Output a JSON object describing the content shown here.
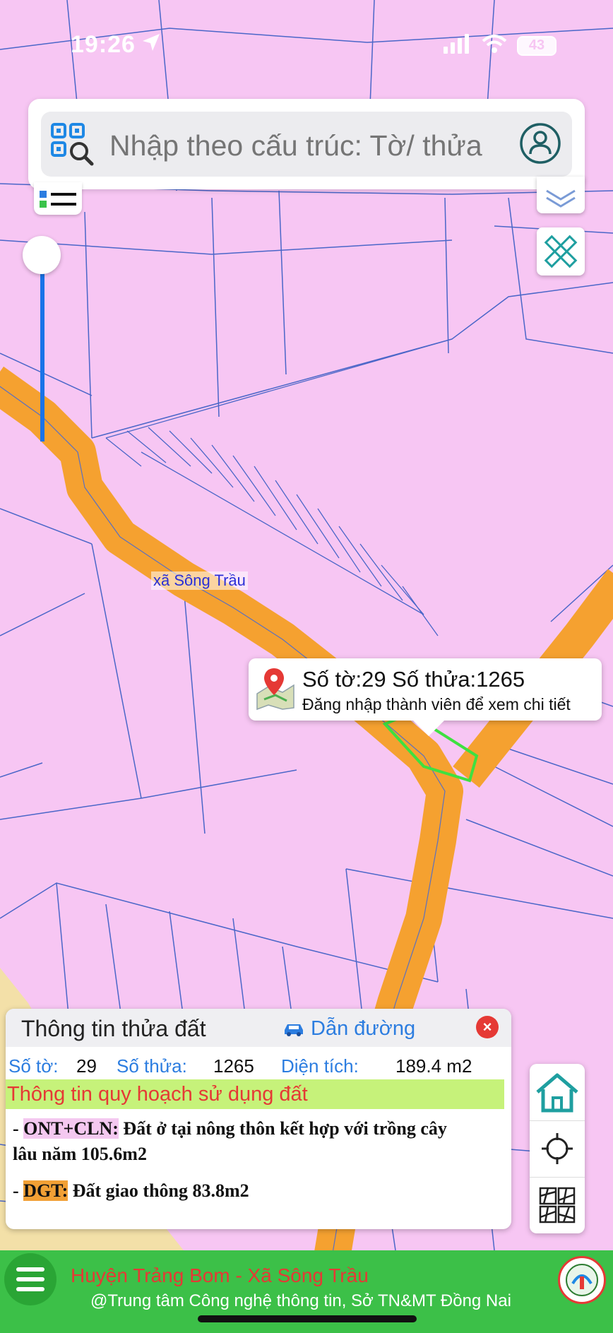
{
  "status_bar": {
    "time": "19:26",
    "battery": "43"
  },
  "search": {
    "placeholder": "Nhập theo cấu trúc: Tờ/ thửa"
  },
  "map": {
    "commune_label": "xã Sông Trầu"
  },
  "parcel_popup": {
    "title": "Số tờ:29 Số thửa:1265",
    "subtitle": "Đăng nhập thành viên để xem chi tiết"
  },
  "info_panel": {
    "title": "Thông tin thửa đất",
    "route_label": "Dẫn đường",
    "close_label": "×",
    "sheet_label": "Số tờ:",
    "sheet_value": "29",
    "parcel_label": "Số thửa:",
    "parcel_value": "1265",
    "area_label": "Diện tích:",
    "area_value": "189.4 m2",
    "plan_title": "Thông tin quy hoạch sử dụng đất",
    "plans": [
      {
        "prefix": "- ",
        "code": "ONT+CLN:",
        "desc": " Đất ở tại nông thôn kết hợp với trồng cây",
        "desc2": "lâu năm 105.6m2"
      },
      {
        "prefix": "- ",
        "code": "DGT:",
        "desc": " Đất giao thông 83.8m2"
      }
    ]
  },
  "footer": {
    "line1": "Huyện Trảng Bom - Xã Sông Trầu",
    "line2": "@Trung tâm Công nghệ thông tin, Sở TN&MT Đồng Nai"
  }
}
